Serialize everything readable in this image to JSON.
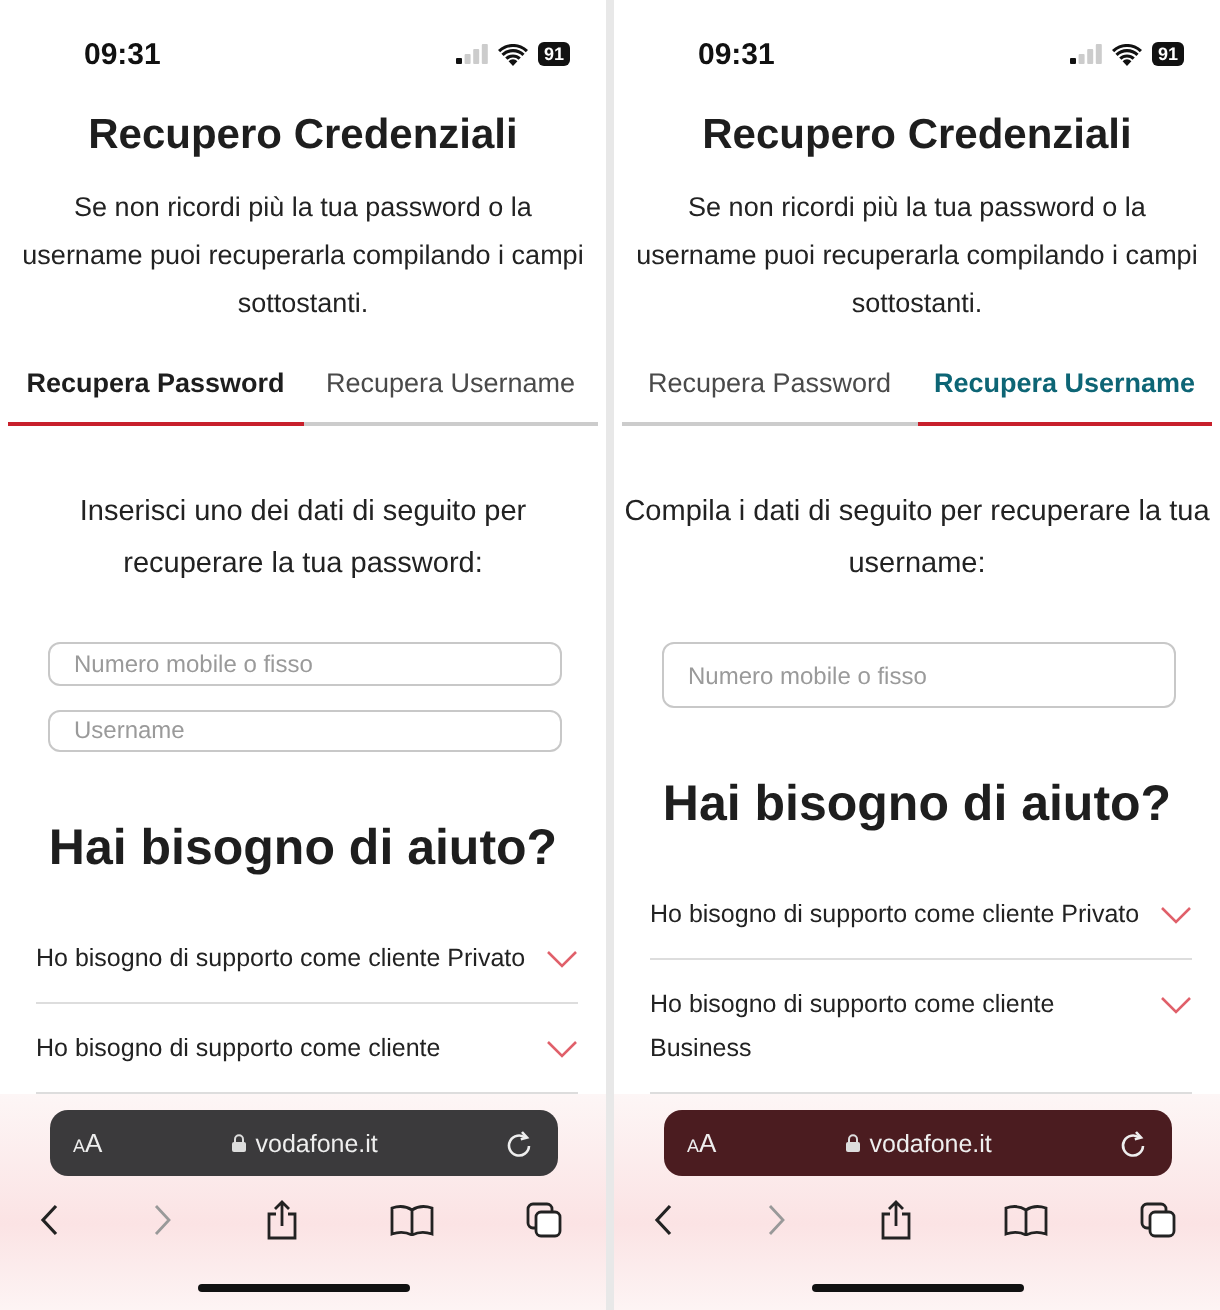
{
  "phones": [
    {
      "status_bar": {
        "time": "09:31",
        "battery": "91"
      },
      "title": "Recupero Credenziali",
      "description": "Se non ricordi più la tua password o la username puoi recuperarla compilando i campi sottostanti.",
      "tabs": [
        {
          "label": "Recupera Password",
          "selected": true,
          "color": "#1e1e1e"
        },
        {
          "label": "Recupera Username",
          "selected": false,
          "color": "#4a4a4a"
        }
      ],
      "instruction": "Inserisci uno dei dati di seguito per recuperare la tua password:",
      "fields": [
        {
          "placeholder": "Numero mobile o fisso"
        },
        {
          "placeholder": "Username"
        }
      ],
      "help_heading": "Hai bisogno di aiuto?",
      "faq": [
        {
          "label": "Ho bisogno di supporto come cliente Privato",
          "expanded": false
        },
        {
          "label": "Ho bisogno di supporto come cliente",
          "expanded": false
        }
      ],
      "browser": {
        "text_size": "AA",
        "url": "vodafone.it",
        "color": "#3b3a3c"
      }
    },
    {
      "status_bar": {
        "time": "09:31",
        "battery": "91"
      },
      "title": "Recupero Credenziali",
      "description": "Se non ricordi più la tua password o la username puoi recuperarla compilando i campi sottostanti.",
      "tabs": [
        {
          "label": "Recupera Password",
          "selected": false,
          "color": "#4a4a4a"
        },
        {
          "label": "Recupera Username",
          "selected": true,
          "color": "#0d6575"
        }
      ],
      "instruction": "Compila i dati di seguito per recuperare la tua username:",
      "fields": [
        {
          "placeholder": "Numero mobile o fisso"
        }
      ],
      "help_heading": "Hai bisogno di aiuto?",
      "faq": [
        {
          "label": "Ho bisogno di supporto come cliente Privato",
          "expanded": false
        },
        {
          "label": "Ho bisogno di supporto come cliente Business",
          "expanded": false
        }
      ],
      "browser": {
        "text_size": "AA",
        "url": "vodafone.it",
        "color": "#4b1c20"
      }
    }
  ]
}
